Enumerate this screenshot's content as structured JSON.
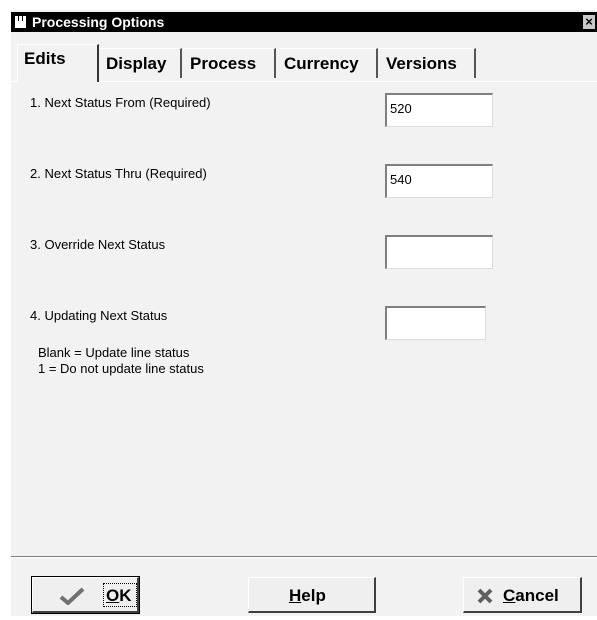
{
  "window": {
    "title": "Processing Options",
    "close_glyph": "×"
  },
  "tabs": [
    {
      "label": "Edits",
      "active": true
    },
    {
      "label": "Display",
      "active": false
    },
    {
      "label": "Process",
      "active": false
    },
    {
      "label": "Currency",
      "active": false
    },
    {
      "label": "Versions",
      "active": false
    }
  ],
  "options": [
    {
      "label": "1.  Next Status From  (Required)",
      "value": "520"
    },
    {
      "label": "2.  Next Status Thru  (Required)",
      "value": "540"
    },
    {
      "label": "3.  Override Next Status",
      "value": ""
    },
    {
      "label": "4.  Updating Next Status",
      "value": ""
    }
  ],
  "option4_help": [
    "Blank = Update line status",
    "1 = Do not update line status"
  ],
  "buttons": {
    "ok": {
      "mnemonic": "O",
      "rest": "K",
      "icon": "checkmark-icon"
    },
    "help": {
      "mnemonic": "H",
      "rest": "elp"
    },
    "cancel": {
      "mnemonic": "C",
      "rest": "ancel",
      "icon": "x-icon"
    }
  }
}
